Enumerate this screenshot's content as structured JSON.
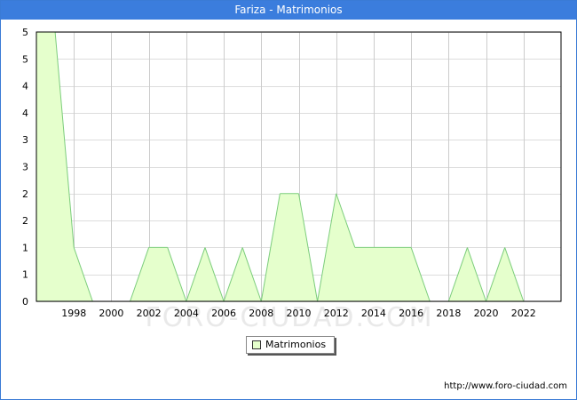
{
  "header": {
    "title": "Fariza - Matrimonios"
  },
  "watermark": "FORO-CIUDAD.COM",
  "footer": {
    "url": "http://www.foro-ciudad.com"
  },
  "chart_data": {
    "type": "area",
    "title": "Fariza - Matrimonios",
    "xlabel": "",
    "ylabel": "",
    "xlim": [
      1996,
      2024
    ],
    "ylim": [
      0,
      5
    ],
    "x_tick_values": [
      1998,
      2000,
      2002,
      2004,
      2006,
      2008,
      2010,
      2012,
      2014,
      2016,
      2018,
      2020,
      2022
    ],
    "x_tick_labels": [
      "1998",
      "2000",
      "2002",
      "2004",
      "2006",
      "2008",
      "2010",
      "2012",
      "2014",
      "2016",
      "2018",
      "2020",
      "2022"
    ],
    "y_tick_values": [
      0,
      0.5,
      1,
      1.5,
      2,
      2.5,
      3,
      3.5,
      4,
      4.5,
      5
    ],
    "y_tick_labels": [
      "0",
      "1",
      "1",
      "2",
      "2",
      "3",
      "3",
      "4",
      "4",
      "5",
      "5"
    ],
    "grid": true,
    "legend": "bottom-center",
    "series": [
      {
        "name": "Matrimonios",
        "color_fill": "#e5ffcc",
        "color_line": "#7ccd7c",
        "x": [
          1996,
          1997,
          1998,
          1999,
          2000,
          2001,
          2002,
          2003,
          2004,
          2005,
          2006,
          2007,
          2008,
          2009,
          2010,
          2011,
          2012,
          2013,
          2014,
          2015,
          2016,
          2017,
          2018,
          2019,
          2020,
          2021,
          2022
        ],
        "y": [
          5,
          5,
          1,
          0,
          0,
          0,
          1,
          1,
          0,
          1,
          0,
          1,
          0,
          2,
          2,
          0,
          2,
          1,
          1,
          1,
          1,
          0,
          0,
          1,
          0,
          1,
          0
        ]
      }
    ]
  }
}
